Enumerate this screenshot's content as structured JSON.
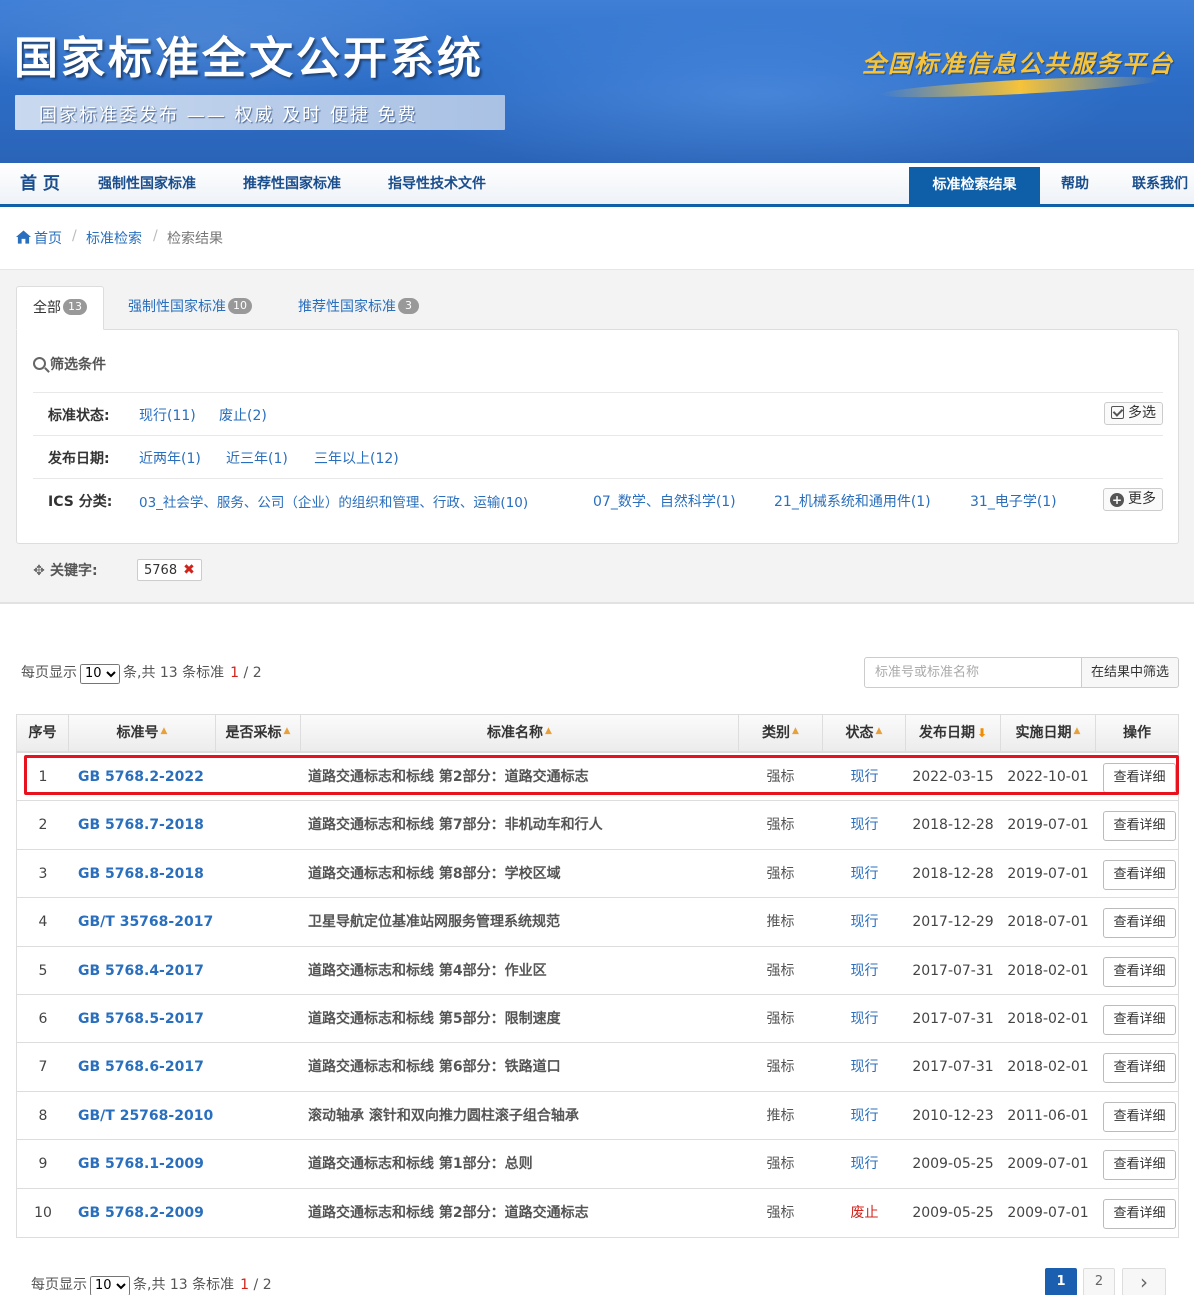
{
  "header": {
    "title": "国家标准全文公开系统",
    "slogan": "国家标准委发布 —— 权威 及时 便捷 免费",
    "platform": "全国标准信息公共服务平台"
  },
  "nav": {
    "home": "首 页",
    "mandatory": "强制性国家标准",
    "recommended": "推荐性国家标准",
    "guidance": "指导性技术文件",
    "results": "标准检索结果",
    "help": "帮助",
    "contact": "联系我们"
  },
  "breadcrumb": {
    "home": "首页",
    "search": "标准检索",
    "current": "检索结果",
    "sep": "/"
  },
  "tabs": [
    {
      "label": "全部",
      "count": "13"
    },
    {
      "label": "强制性国家标准",
      "count": "10"
    },
    {
      "label": "推荐性国家标准",
      "count": "3"
    }
  ],
  "filter": {
    "heading": "筛选条件",
    "status_label": "标准状态:",
    "status_opts": [
      "现行(11)",
      "废止(2)"
    ],
    "multi_label": "多选",
    "date_label": "发布日期:",
    "date_opts": [
      "近两年(1)",
      "近三年(1)",
      "三年以上(12)"
    ],
    "ics_label": "ICS 分类:",
    "ics_opts": [
      "03_社会学、服务、公司（企业）的组织和管理、行政、运输(10)",
      "07_数学、自然科学(1)",
      "21_机械系统和通用件(1)",
      "31_电子学(1)"
    ],
    "more_label": "更多",
    "keyword_label": "关键字:",
    "keyword_value": "5768"
  },
  "paging": {
    "per_page_prefix": "每页显示",
    "per_page": "10",
    "suffix": "条,共 13 条标准",
    "current": "1",
    "total_pages": "/ 2",
    "pages": [
      "1",
      "2"
    ],
    "next": "›"
  },
  "search": {
    "placeholder": "标准号或标准名称",
    "button": "在结果中筛选"
  },
  "table": {
    "headers": {
      "no": "序号",
      "code": "标准号",
      "adopted": "是否采标",
      "name": "标准名称",
      "type": "类别",
      "status": "状态",
      "pub": "发布日期",
      "imp": "实施日期",
      "op": "操作"
    },
    "sort_up": "▲",
    "sort_down": "⬇",
    "view_label": "查看详细",
    "rows": [
      {
        "no": "1",
        "code": "GB 5768.2-2022",
        "name": "道路交通标志和标线 第2部分：道路交通标志",
        "type": "强标",
        "status": "现行",
        "pub": "2022-03-15",
        "imp": "2022-10-01"
      },
      {
        "no": "2",
        "code": "GB 5768.7-2018",
        "name": "道路交通标志和标线 第7部分：非机动车和行人",
        "type": "强标",
        "status": "现行",
        "pub": "2018-12-28",
        "imp": "2019-07-01"
      },
      {
        "no": "3",
        "code": "GB 5768.8-2018",
        "name": "道路交通标志和标线 第8部分：学校区域",
        "type": "强标",
        "status": "现行",
        "pub": "2018-12-28",
        "imp": "2019-07-01"
      },
      {
        "no": "4",
        "code": "GB/T 35768-2017",
        "name": "卫星导航定位基准站网服务管理系统规范",
        "type": "推标",
        "status": "现行",
        "pub": "2017-12-29",
        "imp": "2018-07-01"
      },
      {
        "no": "5",
        "code": "GB 5768.4-2017",
        "name": "道路交通标志和标线 第4部分：作业区",
        "type": "强标",
        "status": "现行",
        "pub": "2017-07-31",
        "imp": "2018-02-01"
      },
      {
        "no": "6",
        "code": "GB 5768.5-2017",
        "name": "道路交通标志和标线 第5部分：限制速度",
        "type": "强标",
        "status": "现行",
        "pub": "2017-07-31",
        "imp": "2018-02-01"
      },
      {
        "no": "7",
        "code": "GB 5768.6-2017",
        "name": "道路交通标志和标线 第6部分：铁路道口",
        "type": "强标",
        "status": "现行",
        "pub": "2017-07-31",
        "imp": "2018-02-01"
      },
      {
        "no": "8",
        "code": "GB/T 25768-2010",
        "name": "滚动轴承 滚针和双向推力圆柱滚子组合轴承",
        "type": "推标",
        "status": "现行",
        "pub": "2010-12-23",
        "imp": "2011-06-01"
      },
      {
        "no": "9",
        "code": "GB 5768.1-2009",
        "name": "道路交通标志和标线 第1部分：总则",
        "type": "强标",
        "status": "现行",
        "pub": "2009-05-25",
        "imp": "2009-07-01"
      },
      {
        "no": "10",
        "code": "GB 5768.2-2009",
        "name": "道路交通标志和标线 第2部分：道路交通标志",
        "type": "强标",
        "status": "废止",
        "pub": "2009-05-25",
        "imp": "2009-07-01"
      }
    ]
  },
  "colors": {
    "header_blue": "#2d6ec8",
    "nav_active": "#0e5ea8",
    "link": "#2a6fbd",
    "abolished": "#d0231b",
    "highlight": "#e8121e",
    "platform_gold": "#f6c33a"
  }
}
